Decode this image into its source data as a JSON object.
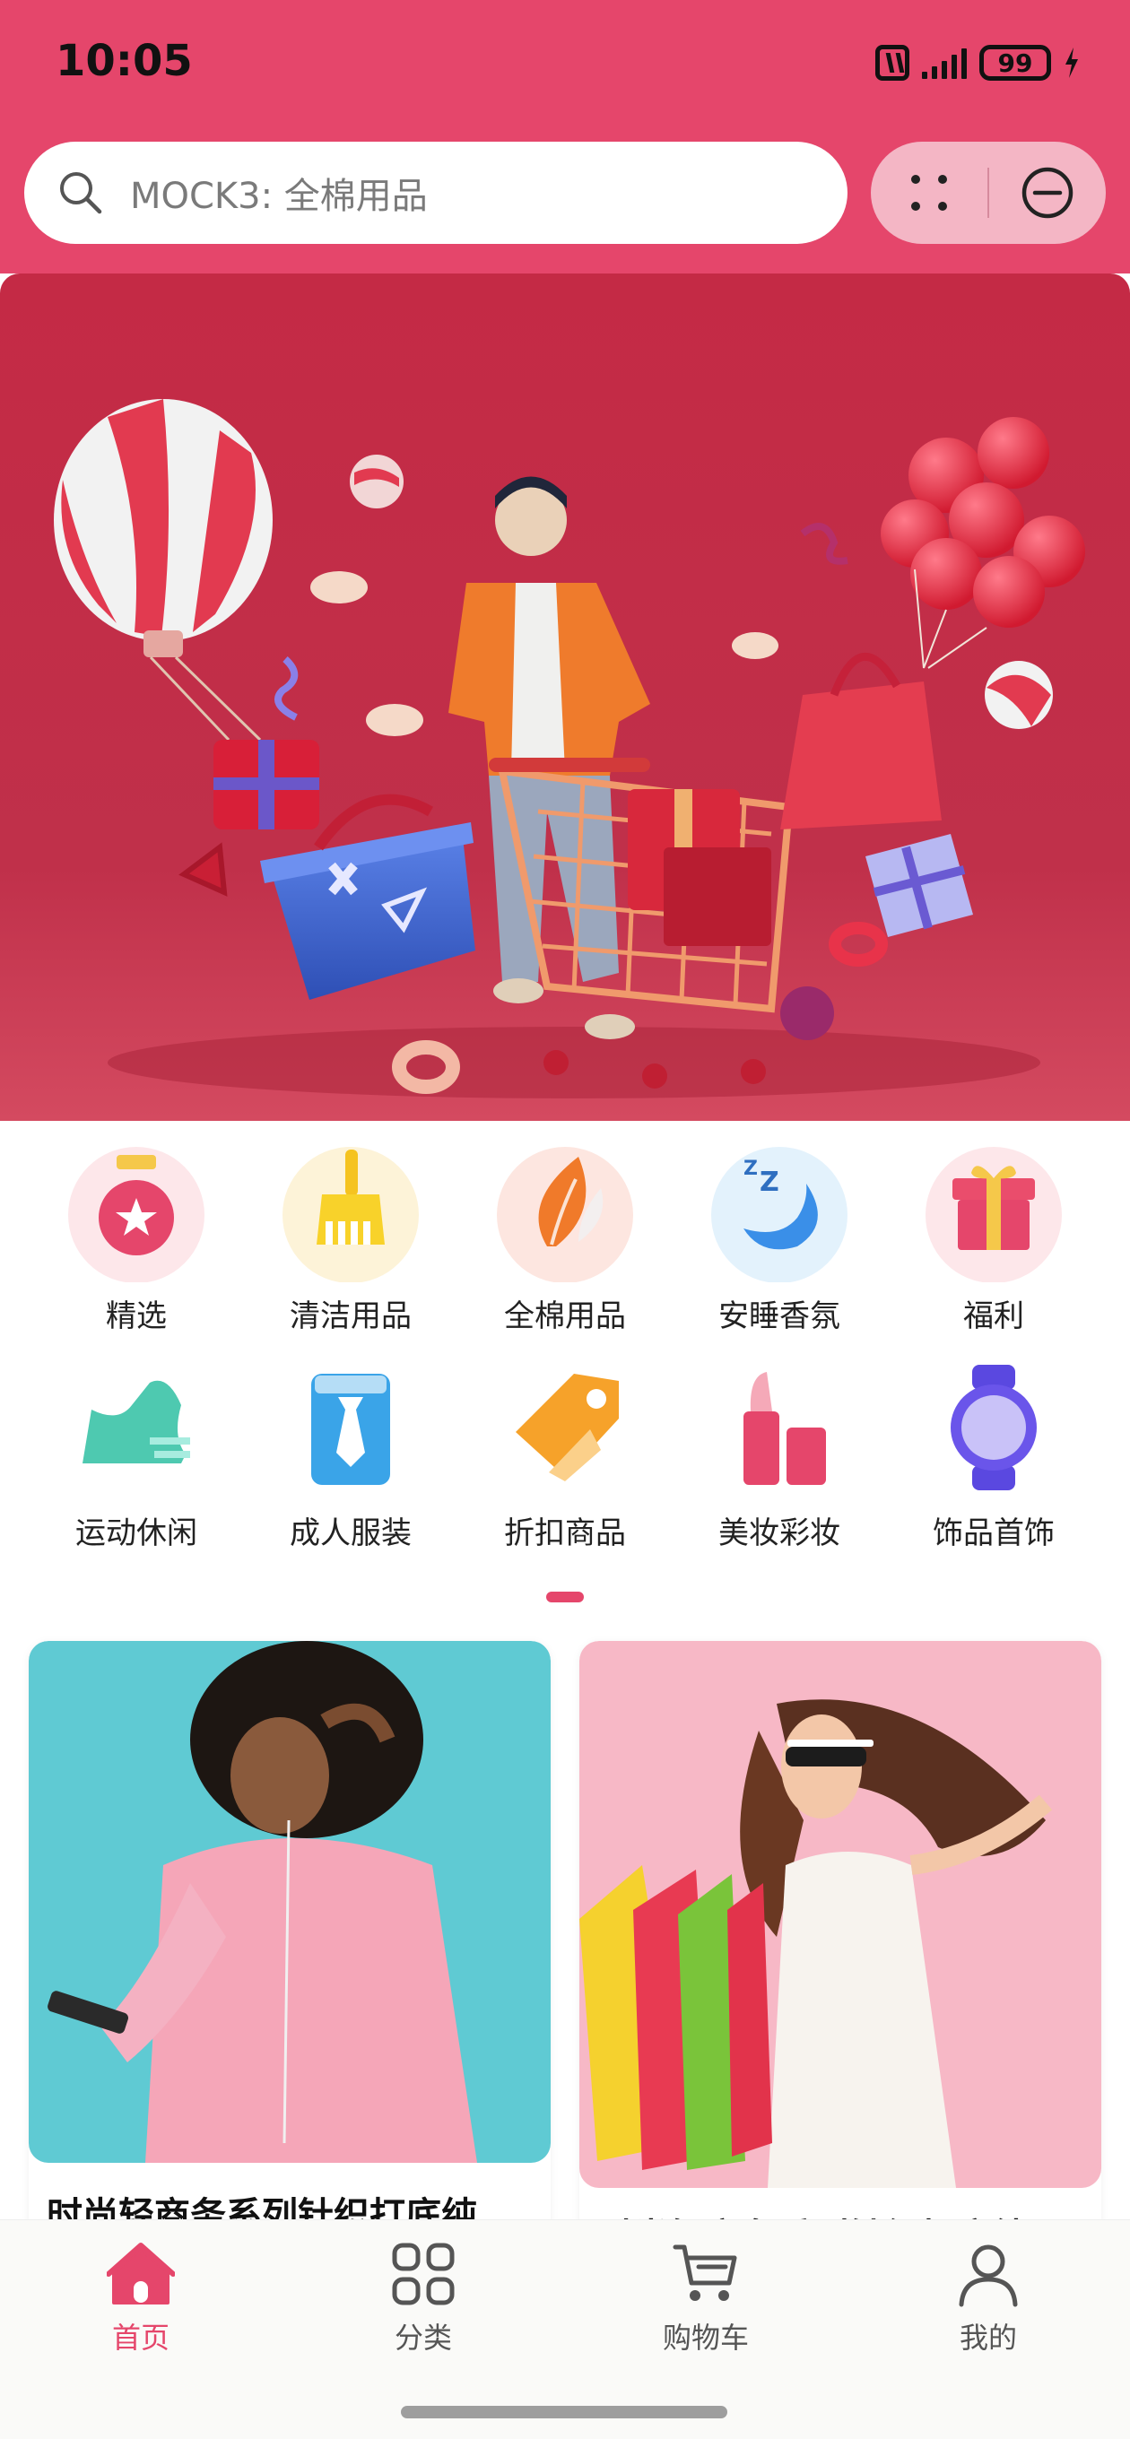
{
  "status_bar": {
    "time": "10:05",
    "battery": "99"
  },
  "search": {
    "placeholder": "MOCK3: 全棉用品"
  },
  "categories": [
    {
      "label": "精选",
      "icon": "medal-star-icon"
    },
    {
      "label": "清洁用品",
      "icon": "broom-icon"
    },
    {
      "label": "全棉用品",
      "icon": "leaf-icon"
    },
    {
      "label": "安睡香氛",
      "icon": "moon-sleep-icon"
    },
    {
      "label": "福利",
      "icon": "gift-icon"
    },
    {
      "label": "运动休闲",
      "icon": "sneaker-icon"
    },
    {
      "label": "成人服装",
      "icon": "shirt-tie-icon"
    },
    {
      "label": "折扣商品",
      "icon": "price-tag-icon"
    },
    {
      "label": "美妆彩妆",
      "icon": "lipstick-icon"
    },
    {
      "label": "饰品首饰",
      "icon": "watch-icon"
    }
  ],
  "products": [
    {
      "title": "时尚轻商务系列针织打底纯"
    },
    {
      "title": "时尚轻商务系列针织打底纯"
    }
  ],
  "tabbar": {
    "items": [
      {
        "label": "首页",
        "icon": "home-icon",
        "active": true
      },
      {
        "label": "分类",
        "icon": "grid-icon",
        "active": false
      },
      {
        "label": "购物车",
        "icon": "cart-icon",
        "active": false
      },
      {
        "label": "我的",
        "icon": "user-icon",
        "active": false
      }
    ]
  },
  "colors": {
    "accent": "#e5466b",
    "banner": "#c42a45"
  }
}
